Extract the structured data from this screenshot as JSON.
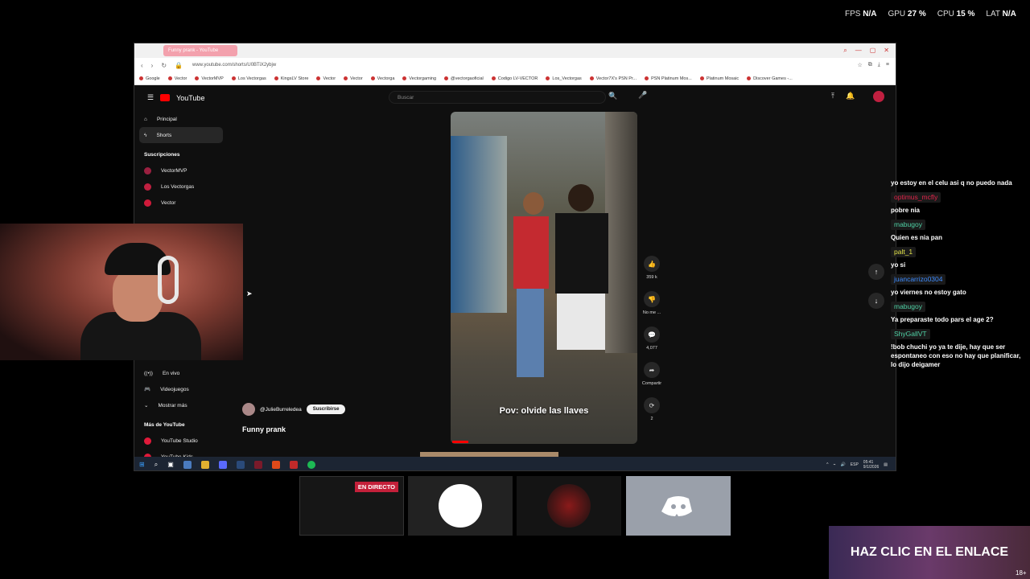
{
  "stats": {
    "fps_label": "FPS",
    "fps": "N/A",
    "gpu_label": "GPU",
    "gpu": "27 %",
    "cpu_label": "CPU",
    "cpu": "15 %",
    "lat_label": "LAT",
    "lat": "N/A"
  },
  "browser": {
    "tab_title": "Funny prank - YouTube",
    "url": "www.youtube.com/shorts/U0BTiX2ybjw",
    "bookmarks": [
      "Google",
      "Vector",
      "VectorMVP",
      "Los Vectorgas",
      "KingsLV Store",
      "Vector",
      "Vector",
      "Vectorga",
      "Vectorgaming",
      "@vectorgaoficial",
      "Codigo LV-VECTOR",
      "Los_Vectorgas",
      "Vector7X's PSN Pr...",
      "PSN Platinum Mos...",
      "Platinum Mosaic",
      "Discover Games -..."
    ]
  },
  "youtube": {
    "logo": "YouTube",
    "search_placeholder": "Buscar",
    "sidebar": [
      {
        "label": "Principal",
        "icon": "home-icon"
      },
      {
        "label": "Shorts",
        "icon": "shorts-icon"
      }
    ],
    "subscriptions_title": "Suscripciones",
    "subscriptions": [
      {
        "label": "VectorMVP",
        "color": "#9b2040"
      },
      {
        "label": "Los Vectorgas",
        "color": "#c02040"
      },
      {
        "label": "Vector",
        "color": "#d01a3a"
      }
    ],
    "sidebar_bottom": [
      {
        "label": "En vivo",
        "icon": "live-icon"
      },
      {
        "label": "Videojuegos",
        "icon": "gamepad-icon"
      },
      {
        "label": "Mostrar más",
        "icon": "chevron-down-icon"
      }
    ],
    "more_title": "Más de YouTube",
    "more": [
      {
        "label": "YouTube Studio"
      },
      {
        "label": "YouTube Kids"
      }
    ],
    "video": {
      "caption": "Pov: olvide las llaves",
      "channel": "@JulieBurreledea",
      "subscribe": "Suscribirse",
      "title": "Funny prank"
    },
    "actions": [
      {
        "icon": "like-icon",
        "glyph": "👍",
        "label": "359 k"
      },
      {
        "icon": "dislike-icon",
        "glyph": "👎",
        "label": "No me ..."
      },
      {
        "icon": "comment-icon",
        "glyph": "💬",
        "label": "4,077"
      },
      {
        "icon": "share-icon",
        "glyph": "➦",
        "label": "Compartir"
      },
      {
        "icon": "remix-icon",
        "glyph": "⟳",
        "label": "2"
      }
    ]
  },
  "taskbar": {
    "lang": "ESP",
    "time": "05:41",
    "date": "9/1/2026"
  },
  "chat": [
    {
      "name": "",
      "text": "yo estoy en el celu asi q no puedo nada"
    },
    {
      "name": "optimus_mcfly",
      "color": "#e0244a",
      "text": "pobre nia"
    },
    {
      "name": "mabugoy",
      "color": "#4fd1a5",
      "text": "Quien es nia pan"
    },
    {
      "name": "palt_1",
      "color": "#e6e64a",
      "text": "yo si"
    },
    {
      "name": "juancarrizo0304",
      "color": "#3d8bff",
      "text": "yo viernes no estoy gato"
    },
    {
      "name": "mabugoy",
      "color": "#4fd1a5",
      "text": "Ya preparaste todo pars el age 2?"
    },
    {
      "name": "ShyGallVT",
      "color": "#4fd1a5",
      "text": "!bob chuchi yo ya te dije, hay que ser espontaneo con eso no hay que planificar, lo dijo deigamer"
    }
  ],
  "live_badge": "EN DIRECTO",
  "banner": "HAZ CLIC EN EL ENLACE",
  "corner_text": "18+"
}
